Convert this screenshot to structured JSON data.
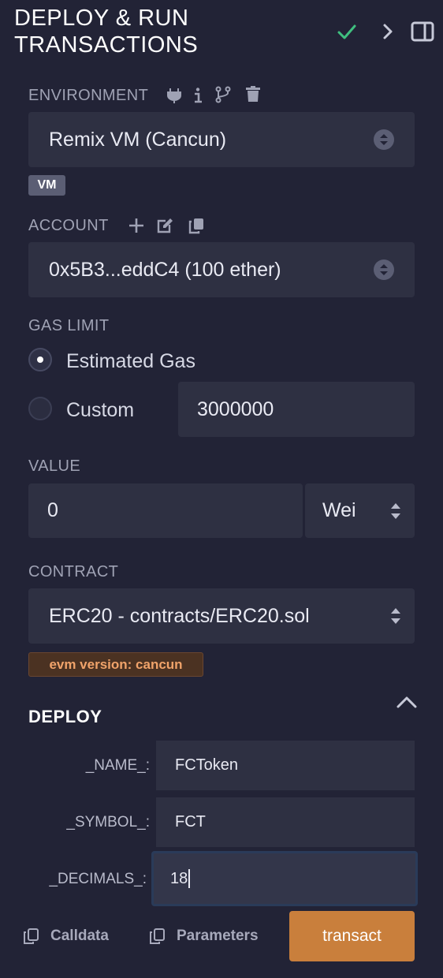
{
  "header": {
    "title_line1": "DEPLOY & RUN",
    "title_line2": "TRANSACTIONS",
    "colors": {
      "check": "#3fbf7f",
      "accent": "#c97f3c"
    }
  },
  "environment": {
    "label": "ENVIRONMENT",
    "selected": "Remix VM (Cancun)",
    "badge": "VM",
    "icons": [
      "plug-icon",
      "info-icon",
      "fork-icon",
      "trash-icon"
    ]
  },
  "account": {
    "label": "ACCOUNT",
    "selected": "0x5B3...eddC4 (100 ether)",
    "icons": [
      "plus-icon",
      "edit-icon",
      "copy-icon"
    ]
  },
  "gas": {
    "label": "GAS LIMIT",
    "option_estimated": "Estimated Gas",
    "option_custom": "Custom",
    "custom_value": "3000000",
    "selected": "Estimated Gas"
  },
  "value": {
    "label": "VALUE",
    "amount": "0",
    "unit": "Wei"
  },
  "contract": {
    "label": "CONTRACT",
    "selected": "ERC20 - contracts/ERC20.sol",
    "evm_badge": "evm version: cancun"
  },
  "deploy": {
    "title": "DEPLOY",
    "params": [
      {
        "label": "_NAME_:",
        "value": "FCToken"
      },
      {
        "label": "_SYMBOL_:",
        "value": "FCT"
      },
      {
        "label": "_DECIMALS_:",
        "value": "18"
      }
    ],
    "calldata_label": "Calldata",
    "parameters_label": "Parameters",
    "transact_label": "transact"
  }
}
